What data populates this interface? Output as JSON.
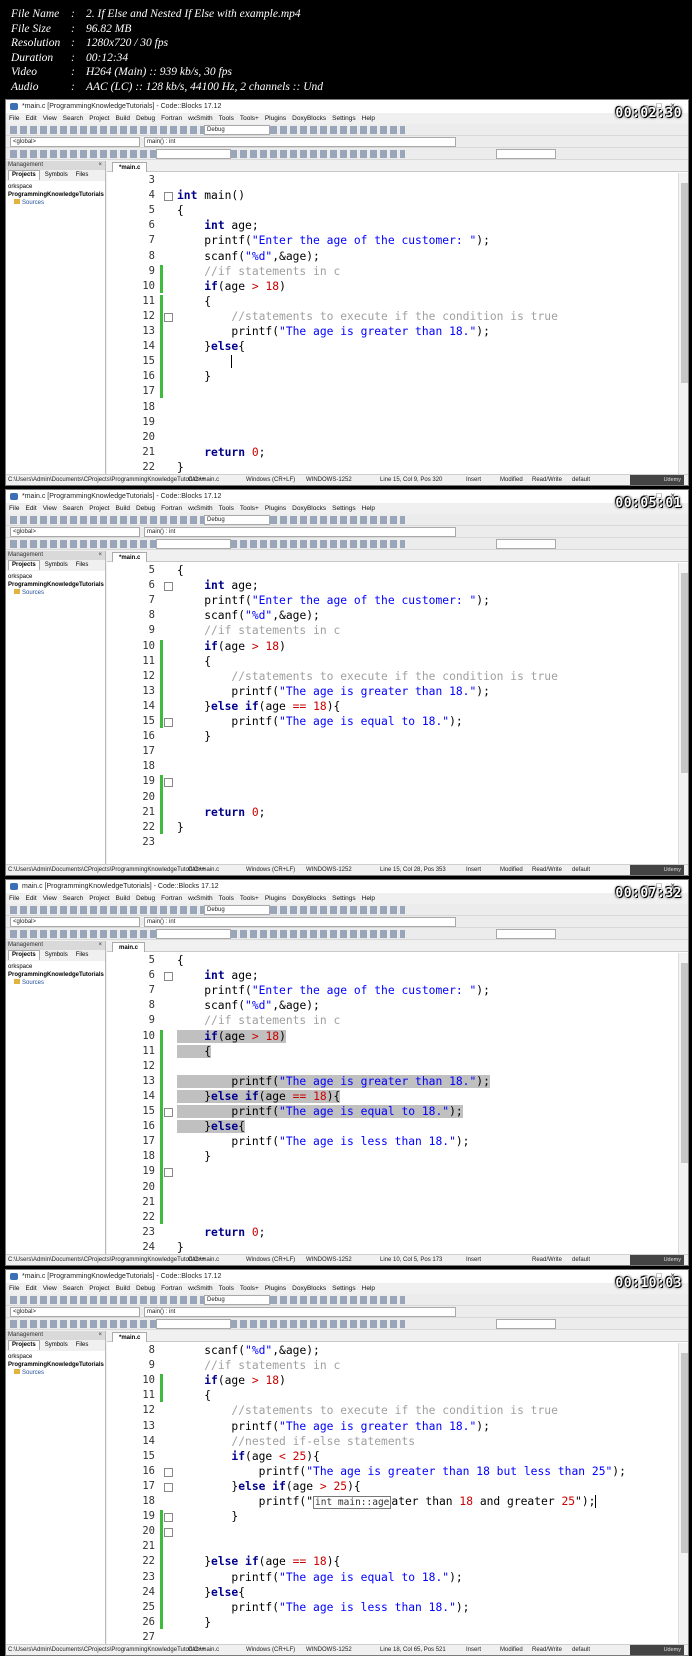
{
  "info": [
    {
      "key": "File Name",
      "value": "2. If Else and Nested If Else with example.mp4"
    },
    {
      "key": "File Size",
      "value": "96.82 MB"
    },
    {
      "key": "Resolution",
      "value": "1280x720 / 30 fps"
    },
    {
      "key": "Duration",
      "value": "00:12:34"
    },
    {
      "key": "Video",
      "value": "H264 (Main) :: 939 kb/s, 30 fps"
    },
    {
      "key": "Audio",
      "value": "AAC (LC) :: 128 kb/s, 44100 Hz, 2 channels :: Und"
    }
  ],
  "menus": [
    "File",
    "Edit",
    "View",
    "Search",
    "Project",
    "Build",
    "Debug",
    "Fortran",
    "wxSmith",
    "Tools",
    "Tools+",
    "Plugins",
    "DoxyBlocks",
    "Settings",
    "Help"
  ],
  "combos": {
    "scope": "<global>",
    "func": "main() : int",
    "build_target": "Debug"
  },
  "management": {
    "title": "Management",
    "tabs": [
      "Projects",
      "Symbols",
      "Files"
    ],
    "workspace": "orkspace",
    "project": "ProgrammingKnowledgeTutorials",
    "folder": "Sources"
  },
  "status_common": {
    "path": "C:\\Users\\Admin\\Documents\\CProjects\\ProgrammingKnowledgeTutorials\\main.c",
    "lang": "C/C++",
    "eol": "Windows (CR+LF)",
    "encoding": "WINDOWS-1252",
    "mode": "Insert",
    "rw": "Read/Write",
    "profile": "default"
  },
  "udemy": "Udemy",
  "frames": [
    {
      "title": "*main.c [ProgrammingKnowledgeTutorials] - Code::Blocks 17.12",
      "tab": "*main.c",
      "timestamp": "00:02:30",
      "status_pos": "Line 15, Col 9, Pos 320",
      "status_modified": "Modified",
      "lines": [
        {
          "n": "3",
          "t": ""
        },
        {
          "n": "4",
          "t": "int main()"
        },
        {
          "n": "5",
          "t": "{"
        },
        {
          "n": "6",
          "t": "    int age;"
        },
        {
          "n": "7",
          "t": "    printf(\"Enter the age of the customer: \");"
        },
        {
          "n": "8",
          "t": "    scanf(\"%d\",&age);"
        },
        {
          "n": "9",
          "t": "    //if statements in c"
        },
        {
          "n": "10",
          "t": "    if(age > 18)"
        },
        {
          "n": "11",
          "t": "    {"
        },
        {
          "n": "12",
          "t": "        //statements to execute if the condition is true"
        },
        {
          "n": "13",
          "t": "        printf(\"The age is greater than 18.\");"
        },
        {
          "n": "14",
          "t": "    }else{"
        },
        {
          "n": "15",
          "t": "        "
        },
        {
          "n": "16",
          "t": "    }"
        },
        {
          "n": "17",
          "t": ""
        },
        {
          "n": "18",
          "t": ""
        },
        {
          "n": "19",
          "t": ""
        },
        {
          "n": "20",
          "t": ""
        },
        {
          "n": "21",
          "t": "    return 0;"
        },
        {
          "n": "22",
          "t": "}"
        }
      ]
    },
    {
      "title": "*main.c [ProgrammingKnowledgeTutorials] - Code::Blocks 17.12",
      "tab": "*main.c",
      "timestamp": "00:05:01",
      "status_pos": "Line 15, Col 28, Pos 353",
      "status_modified": "Modified",
      "lines": [
        {
          "n": "5",
          "t": "{"
        },
        {
          "n": "6",
          "t": "    int age;"
        },
        {
          "n": "7",
          "t": "    printf(\"Enter the age of the customer: \");"
        },
        {
          "n": "8",
          "t": "    scanf(\"%d\",&age);"
        },
        {
          "n": "9",
          "t": "    //if statements in c"
        },
        {
          "n": "10",
          "t": "    if(age > 18)"
        },
        {
          "n": "11",
          "t": "    {"
        },
        {
          "n": "12",
          "t": "        //statements to execute if the condition is true"
        },
        {
          "n": "13",
          "t": "        printf(\"The age is greater than 18.\");"
        },
        {
          "n": "14",
          "t": "    }else if(age == 18){"
        },
        {
          "n": "15",
          "t": "        printf(\"The age is equal to 18.\");"
        },
        {
          "n": "16",
          "t": "    }"
        },
        {
          "n": "17",
          "t": ""
        },
        {
          "n": "18",
          "t": ""
        },
        {
          "n": "19",
          "t": ""
        },
        {
          "n": "20",
          "t": ""
        },
        {
          "n": "21",
          "t": "    return 0;"
        },
        {
          "n": "22",
          "t": "}"
        },
        {
          "n": "23",
          "t": ""
        }
      ]
    },
    {
      "title": "main.c [ProgrammingKnowledgeTutorials] - Code::Blocks 17.12",
      "tab": "main.c",
      "timestamp": "00:07:32",
      "status_pos": "Line 10, Col 5, Pos 173",
      "status_modified": "",
      "lines": [
        {
          "n": "5",
          "t": "{"
        },
        {
          "n": "6",
          "t": "    int age;"
        },
        {
          "n": "7",
          "t": "    printf(\"Enter the age of the customer: \");"
        },
        {
          "n": "8",
          "t": "    scanf(\"%d\",&age);"
        },
        {
          "n": "9",
          "t": "    //if statements in c"
        },
        {
          "n": "10",
          "t": "    if(age > 18)"
        },
        {
          "n": "11",
          "t": "    {"
        },
        {
          "n": "12",
          "t": ""
        },
        {
          "n": "13",
          "t": "        printf(\"The age is greater than 18.\");"
        },
        {
          "n": "14",
          "t": "    }else if(age == 18){"
        },
        {
          "n": "15",
          "t": "        printf(\"The age is equal to 18.\");"
        },
        {
          "n": "16",
          "t": "    }else{"
        },
        {
          "n": "17",
          "t": "        printf(\"The age is less than 18.\");"
        },
        {
          "n": "18",
          "t": "    }"
        },
        {
          "n": "19",
          "t": ""
        },
        {
          "n": "20",
          "t": ""
        },
        {
          "n": "21",
          "t": ""
        },
        {
          "n": "22",
          "t": ""
        },
        {
          "n": "23",
          "t": "    return 0;"
        },
        {
          "n": "24",
          "t": "}"
        }
      ]
    },
    {
      "title": "*main.c [ProgrammingKnowledgeTutorials] - Code::Blocks 17.12",
      "tab": "*main.c",
      "timestamp": "00:10:03",
      "status_pos": "Line 18, Col 65, Pos 521",
      "status_modified": "Modified",
      "tooltip": "int main::age",
      "lines": [
        {
          "n": "8",
          "t": "    scanf(\"%d\",&age);"
        },
        {
          "n": "9",
          "t": "    //if statements in c"
        },
        {
          "n": "10",
          "t": "    if(age > 18)"
        },
        {
          "n": "11",
          "t": "    {"
        },
        {
          "n": "12",
          "t": "        //statements to execute if the condition is true"
        },
        {
          "n": "13",
          "t": "        printf(\"The age is greater than 18.\");"
        },
        {
          "n": "14",
          "t": "        //nested if-else statements"
        },
        {
          "n": "15",
          "t": "        if(age < 25){"
        },
        {
          "n": "16",
          "t": "            printf(\"The age is greater than 18 but less than 25\");"
        },
        {
          "n": "17",
          "t": "        }else if(age > 25){"
        },
        {
          "n": "18",
          "t": "            printf(\"The age is greater than 18 and greater 25\");"
        },
        {
          "n": "19",
          "t": "        }"
        },
        {
          "n": "20",
          "t": ""
        },
        {
          "n": "21",
          "t": ""
        },
        {
          "n": "22",
          "t": "    }else if(age == 18){"
        },
        {
          "n": "23",
          "t": "        printf(\"The age is equal to 18.\");"
        },
        {
          "n": "24",
          "t": "    }else{"
        },
        {
          "n": "25",
          "t": "        printf(\"The age is less than 18.\");"
        },
        {
          "n": "26",
          "t": "    }"
        },
        {
          "n": "27",
          "t": ""
        }
      ]
    }
  ]
}
